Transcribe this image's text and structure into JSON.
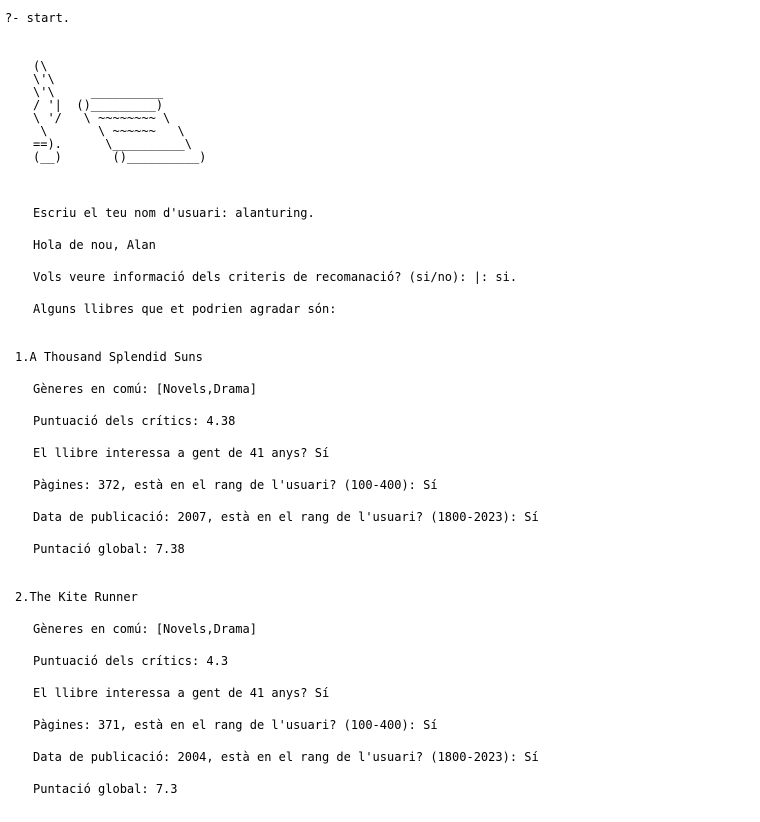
{
  "console": {
    "prompt": "?- start.",
    "ascii_art": "(\\\n\\'\\\n\\'\\     __________\n/ '|  ()_________)\n\\ '/   \\ ~~~~~~~~ \\\n \\       \\ ~~~~~~   \\\n==).      \\__________\\\n(__)       ()__________)",
    "username_prompt": "Escriu el teu nom d'usuari: alanturing.",
    "greeting": "Hola de nou, Alan",
    "info_prompt": "Vols veure informació dels criteris de recomanació? (si/no): |: si.",
    "intro": "Alguns llibres que et podrien agradar són:"
  },
  "books": [
    {
      "title": "1.A Thousand Splendid Suns",
      "genres": "Gèneres en comú: [Novels,Drama]",
      "critics": "Puntuació dels crítics: 4.38",
      "age": "El llibre interessa a gent de 41 anys? Sí",
      "pages": "Pàgines: 372, està en el rang de l'usuari? (100-400): Sí",
      "date": "Data de publicació: 2007, està en el rang de l'usuari? (1800-2023): Sí",
      "score": "Puntació global: 7.38"
    },
    {
      "title": "2.The Kite Runner",
      "genres": "Gèneres en comú: [Novels,Drama]",
      "critics": "Puntuació dels crítics: 4.3",
      "age": "El llibre interessa a gent de 41 anys? Sí",
      "pages": "Pàgines: 371, està en el rang de l'usuari? (100-400): Sí",
      "date": "Data de publicació: 2004, està en el rang de l'usuari? (1800-2023): Sí",
      "score": "Puntació global: 7.3"
    }
  ]
}
